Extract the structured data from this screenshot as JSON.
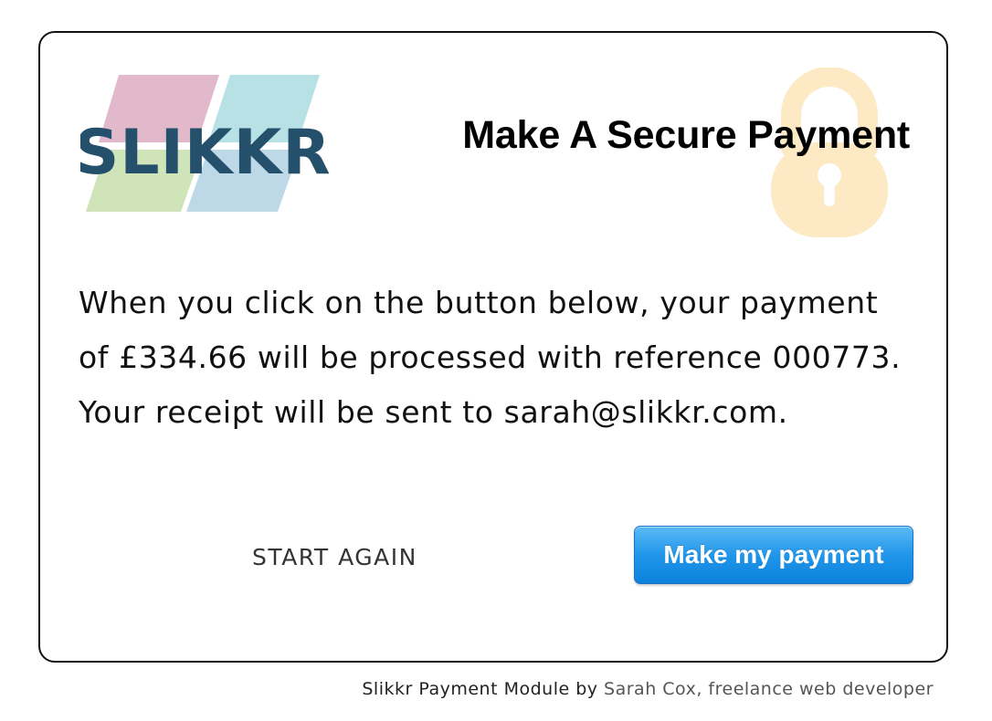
{
  "logo": {
    "text": "SLIKKR",
    "text_color": "#24506b",
    "tile_colors": [
      "#e2b9cb",
      "#b7e1e5",
      "#cfe4b8",
      "#bdd9e8"
    ]
  },
  "lock_icon": {
    "name": "padlock-icon",
    "color": "#fde9c4"
  },
  "header": {
    "title": "Make A Secure Payment"
  },
  "message": {
    "text": "When you click on the button below, your payment of £334.66 will be processed with reference 000773. Your receipt will be sent to sarah@slikkr.com."
  },
  "actions": {
    "start_again_label": "START AGAIN",
    "pay_label": "Make my payment",
    "pay_color": "#1a8fe3"
  },
  "footer": {
    "prefix": "Slikkr Payment Module by ",
    "author_link": "Sarah Cox, freelance web developer"
  }
}
